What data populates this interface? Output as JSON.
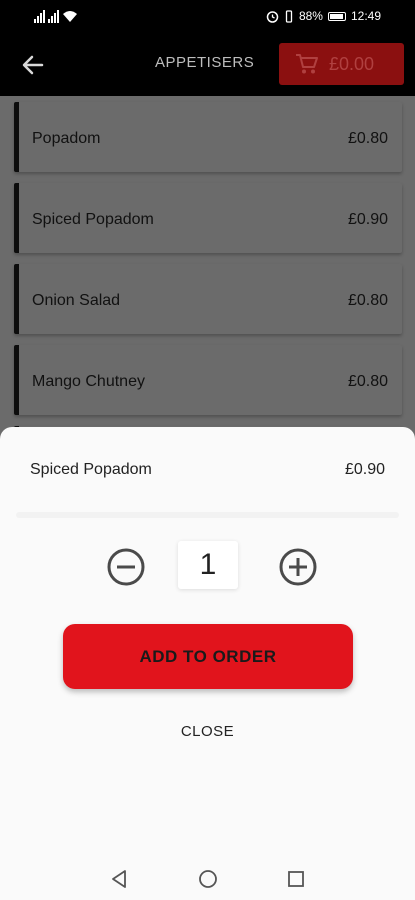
{
  "status_bar": {
    "battery": "88%",
    "time": "12:49"
  },
  "app_bar": {
    "title": "APPETISERS",
    "cart_total": "£0.00",
    "cart_color": "#8b1010"
  },
  "menu_items": [
    {
      "name": "Popadom",
      "price": "£0.80"
    },
    {
      "name": "Spiced Popadom",
      "price": "£0.90"
    },
    {
      "name": "Onion Salad",
      "price": "£0.80"
    },
    {
      "name": "Mango Chutney",
      "price": "£0.80"
    }
  ],
  "sheet": {
    "item_name": "Spiced Popadom",
    "item_price": "£0.90",
    "quantity": "1",
    "add_label": "ADD TO ORDER",
    "close_label": "CLOSE",
    "accent": "#e1141c"
  },
  "icons": {
    "back": "arrow-left-icon",
    "cart": "cart-icon",
    "minus": "minus-circle-icon",
    "plus": "plus-circle-icon",
    "nav": [
      "back-triangle-icon",
      "home-circle-icon",
      "recents-square-icon"
    ]
  }
}
